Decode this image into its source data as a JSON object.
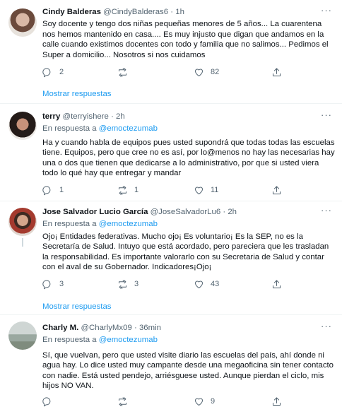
{
  "tweets": [
    {
      "name": "Cindy Balderas",
      "handle": "@CindyBalderas6",
      "dot": "·",
      "time": "1h",
      "reply_to_prefix": "",
      "reply_to_user": "",
      "text": "Soy docente y tengo dos niñas pequeñas menores de 5 años... La cuarentena nos hemos mantenido en casa.... Es muy injusto que digan que andamos en la calle cuando existimos docentes con todo y familia que no salimos... Pedimos el Super a domicilio... Nosotros si nos cuidamos",
      "replies": "2",
      "retweets": "",
      "likes": "82"
    },
    {
      "name": "terry",
      "handle": "@terryishere",
      "dot": "·",
      "time": "2h",
      "reply_to_prefix": "En respuesta a",
      "reply_to_user": "@emoctezumab",
      "text": "Ha y cuando habla de equipos pues usted supondrá que todas todas las escuelas tiene. Equipos, pero que cree no es así, por lo@menos no hay las necesarias hay una o dos que tienen que dedicarse a lo administrativo, por que si usted viera todo lo qué hay que entregar y mandar",
      "replies": "1",
      "retweets": "1",
      "likes": "11"
    },
    {
      "name": "Jose Salvador Lucio García",
      "handle": "@JoseSalvadorLu6",
      "dot": "·",
      "time": "2h",
      "reply_to_prefix": "En respuesta a",
      "reply_to_user": "@emoctezumab",
      "text": "Ojo¡ Entidades federativas. Mucho ojo¡ Es voluntario¡ Es la SEP, no es la Secretaría de Salud. Intuyo que está acordado, pero pareciera que les trasladan la responsabilidad. Es importante valorarlo con su Secretaria de Salud y contar con el aval de su Gobernador. Indicadores¡Ojo¡",
      "replies": "3",
      "retweets": "3",
      "likes": "43"
    },
    {
      "name": "Charly M.",
      "handle": "@CharlyMx09",
      "dot": "·",
      "time": "36min",
      "reply_to_prefix": "En respuesta a",
      "reply_to_user": "@emoctezumab",
      "text": "Sí, que vuelvan, pero que usted visite diario las escuelas del país, ahí donde ni agua hay. Lo dice usted muy campante desde una megaoficina sin tener contacto con nadie. Está usted pendejo, arriésguese usted. Aunque pierdan el ciclo, mis hijos NO VAN.",
      "replies": "",
      "retweets": "",
      "likes": "9"
    }
  ],
  "show_more_label": "Mostrar respuestas",
  "more_glyph": "···",
  "colors": {
    "accent": "#1d9bf0",
    "muted": "#536471",
    "divider": "#eff3f4"
  }
}
